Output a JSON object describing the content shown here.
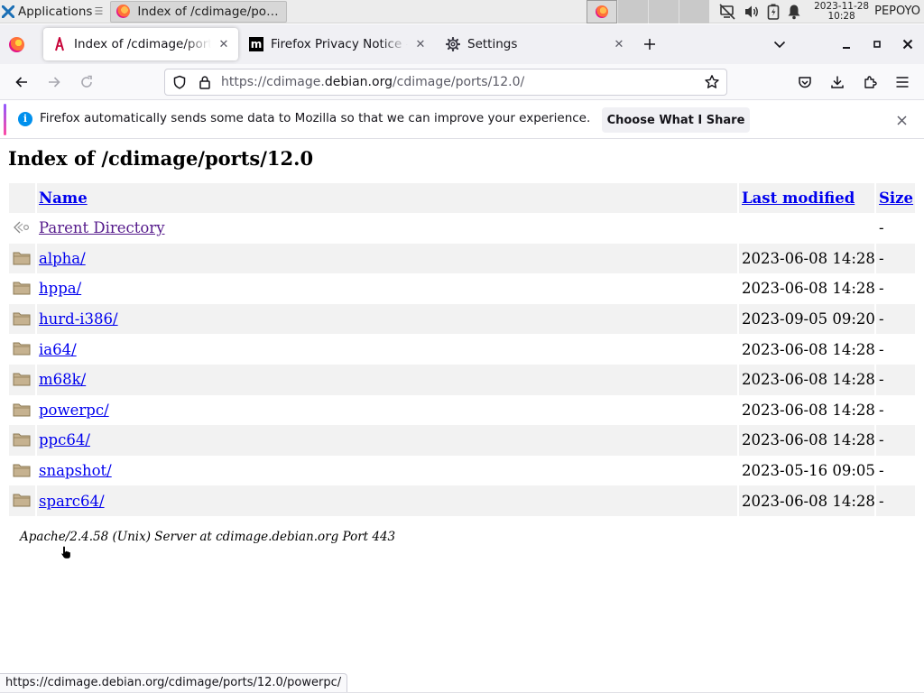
{
  "taskbar": {
    "apps_label": "Applications",
    "apps_sep": "☰",
    "task_label": "Index of /cdimage/ports...",
    "clock_date": "2023-11-28",
    "clock_time": "10:28",
    "user": "PEPOYO"
  },
  "browser": {
    "tabs": [
      {
        "label": "Index of /cdimage/ports/",
        "selected": true,
        "icon": "debian-swirl-icon"
      },
      {
        "label": "Firefox Privacy Notice —",
        "selected": false,
        "icon": "mozilla-m-icon"
      },
      {
        "label": "Settings",
        "selected": false,
        "icon": "gear-icon"
      }
    ],
    "url": {
      "prefix": "https://cdimage.",
      "host": "debian.org",
      "path": "/cdimage/ports/12.0/"
    }
  },
  "notification": {
    "text": "Firefox automatically sends some data to Mozilla so that we can improve your experience.",
    "button": "Choose What I Share"
  },
  "page": {
    "title": "Index of /cdimage/ports/12.0",
    "headers": {
      "name": "Name",
      "modified": "Last modified",
      "size": "Size"
    },
    "parent": {
      "name": "Parent Directory",
      "size": "-"
    },
    "rows": [
      {
        "name": "alpha/",
        "modified": "2023-06-08 14:28",
        "size": "-"
      },
      {
        "name": "hppa/",
        "modified": "2023-06-08 14:28",
        "size": "-"
      },
      {
        "name": "hurd-i386/",
        "modified": "2023-09-05 09:20",
        "size": "-"
      },
      {
        "name": "ia64/",
        "modified": "2023-06-08 14:28",
        "size": "-"
      },
      {
        "name": "m68k/",
        "modified": "2023-06-08 14:28",
        "size": "-"
      },
      {
        "name": "powerpc/",
        "modified": "2023-06-08 14:28",
        "size": "-"
      },
      {
        "name": "ppc64/",
        "modified": "2023-06-08 14:28",
        "size": "-"
      },
      {
        "name": "snapshot/",
        "modified": "2023-05-16 09:05",
        "size": "-"
      },
      {
        "name": "sparc64/",
        "modified": "2023-06-08 14:28",
        "size": "-"
      }
    ],
    "footer": "Apache/2.4.58 (Unix) Server at cdimage.debian.org Port 443"
  },
  "status_link": "https://cdimage.debian.org/cdimage/ports/12.0/powerpc/",
  "colors": {
    "link": "#0000ee",
    "visited_link": "#551a8b",
    "row_shade": "#f2f2f2",
    "folder": "#b8a27a"
  }
}
